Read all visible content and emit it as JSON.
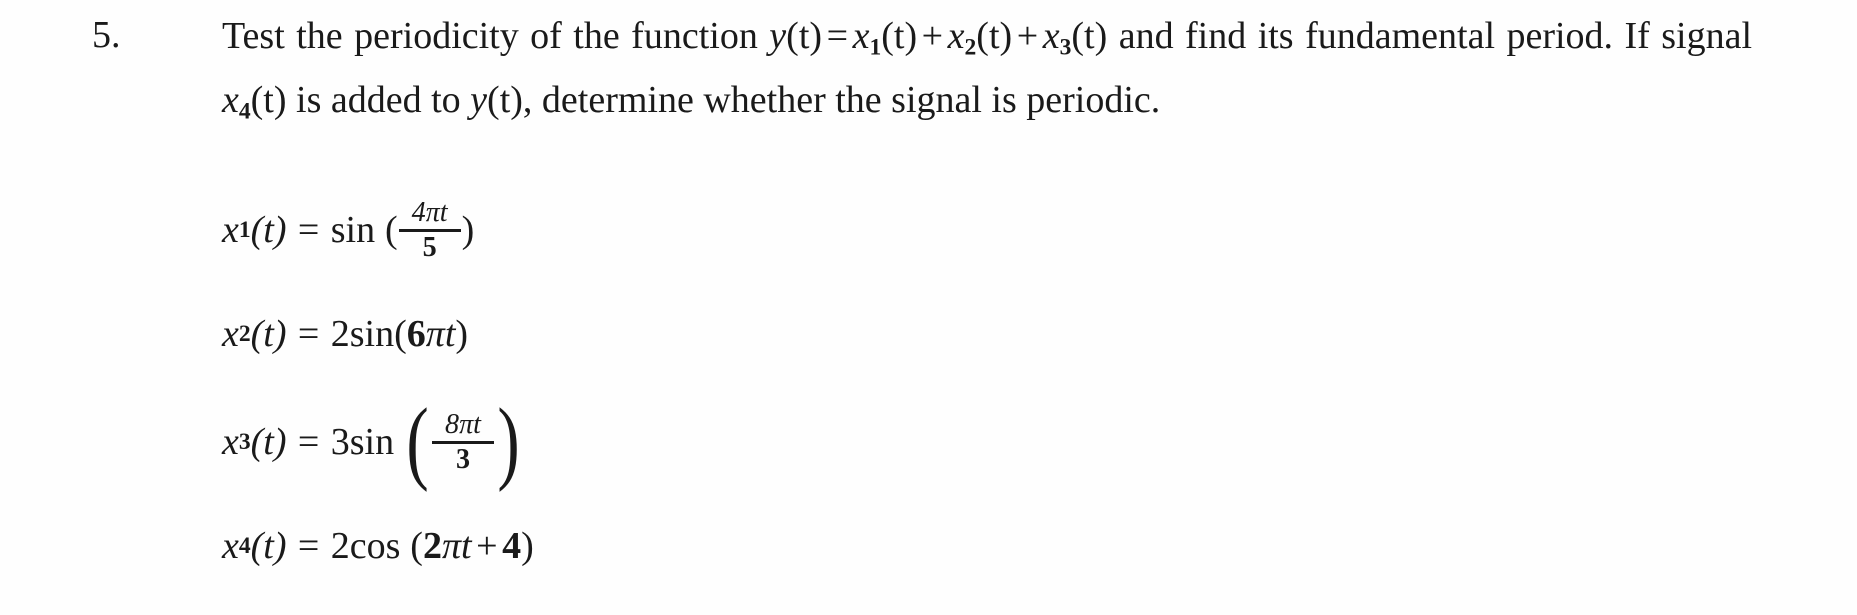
{
  "question": {
    "number": "5.",
    "statement_parts": {
      "s1": "Test  the  periodicity  of  the  function",
      "eq_y": {
        "lhs_y": "y",
        "of_t": "(t)",
        "eq": "=",
        "x1": "x",
        "sub1": "1",
        "plus": "+",
        "x2": "x",
        "sub2": "2",
        "x3": "x",
        "sub3": "3"
      },
      "s2": "and  find  its",
      "s3": "fundamental period. If signal",
      "x4_ref": {
        "x": "x",
        "sub": "4",
        "of_t": "(t)"
      },
      "s4": "is added to",
      "y_ref": {
        "y": "y",
        "of_t": "(t)"
      },
      "s5": ", determine whether the signal is",
      "s6": "periodic."
    }
  },
  "equations": [
    {
      "id": "x1",
      "lhs_var": "x",
      "lhs_sub": "1",
      "lhs_arg": "(t)",
      "equals": "=",
      "coefficient": "",
      "function": "sin",
      "open_paren": "(",
      "close_paren": ")",
      "numerator": "4πt",
      "denominator": "5",
      "plain": "x₁(t) = sin (4πt/5)"
    },
    {
      "id": "x2",
      "lhs_var": "x",
      "lhs_sub": "2",
      "lhs_arg": "(t)",
      "equals": "=",
      "coefficient": "2 ",
      "function": "sin",
      "open_paren": "(",
      "close_paren": ")",
      "argument_coef": "6",
      "argument_pi": "π",
      "argument_var": "t",
      "plain": "x₂(t) = 2 sin(6πt)"
    },
    {
      "id": "x3",
      "lhs_var": "x",
      "lhs_sub": "3",
      "lhs_arg": "(t)",
      "equals": "=",
      "coefficient": "3",
      "function": "sin",
      "open_paren": "(",
      "close_paren": ")",
      "numerator": "8πt",
      "denominator": "3",
      "plain": "x₃(t) = 3sin (8πt/3)"
    },
    {
      "id": "x4",
      "lhs_var": "x",
      "lhs_sub": "4",
      "lhs_arg": "(t)",
      "equals": "=",
      "coefficient": "2",
      "function": "cos",
      "open_paren": "(",
      "close_paren": ")",
      "argument_coef": "2",
      "argument_pi": "π",
      "argument_var": "t",
      "argument_op": "+",
      "argument_const": "4",
      "plain": "x₄(t) = 2cos (2πt + 4)"
    }
  ],
  "colors": {
    "background": "#fefefe",
    "text": "#1a1a1a"
  }
}
